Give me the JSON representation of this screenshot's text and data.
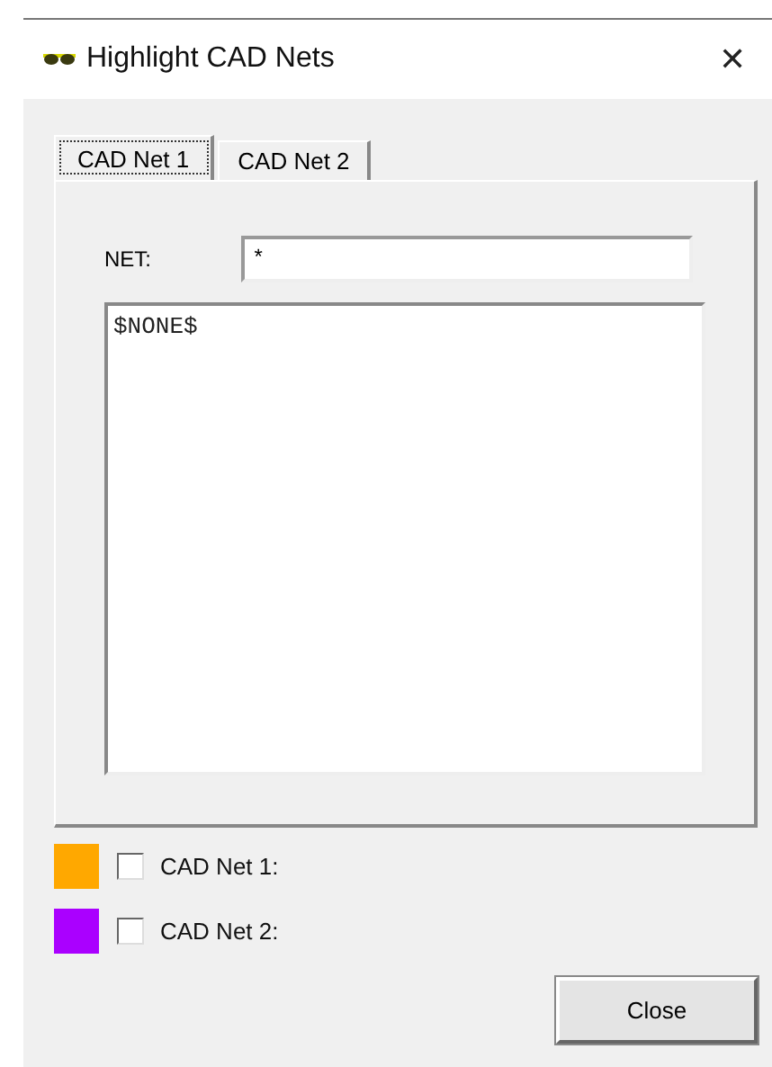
{
  "window": {
    "title": "Highlight CAD Nets",
    "close": "✕"
  },
  "tabs": [
    {
      "label": "CAD Net 1",
      "selected": true
    },
    {
      "label": "CAD Net 2",
      "selected": false
    }
  ],
  "net_field": {
    "label": "NET:",
    "value": "*"
  },
  "net_list": {
    "value": "$NONE$"
  },
  "nets": [
    {
      "label": "CAD Net 1:",
      "color": "#ffa800",
      "checked": false
    },
    {
      "label": "CAD Net 2:",
      "color": "#aa00ff",
      "checked": false
    }
  ],
  "buttons": [
    {
      "label": "Close"
    }
  ]
}
